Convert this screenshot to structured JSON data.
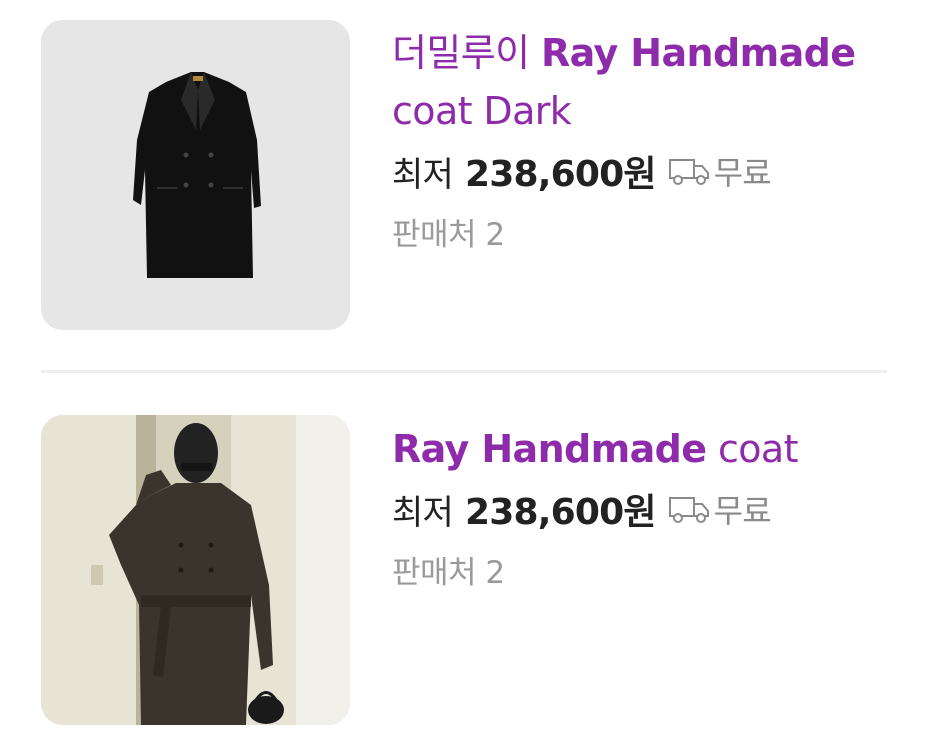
{
  "products": [
    {
      "brand": "더밀루이",
      "name_bold": "Ray Handmade",
      "name_rest": "coat Dark",
      "price_prefix": "최저",
      "price": "238,600원",
      "shipping": "무료",
      "sellers": "판매처 2"
    },
    {
      "brand": "",
      "name_bold": "Ray Handmade",
      "name_rest": "coat",
      "price_prefix": "최저",
      "price": "238,600원",
      "shipping": "무료",
      "sellers": "판매처 2"
    }
  ],
  "colors": {
    "title": "#8e2bab",
    "price": "#222222",
    "muted": "#9a9a9a"
  }
}
